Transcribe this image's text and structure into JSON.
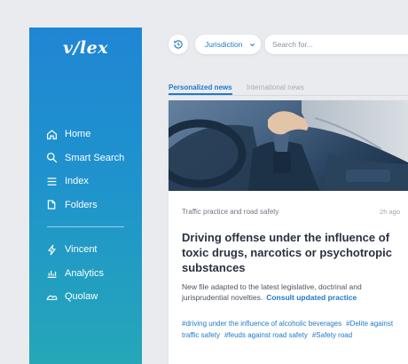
{
  "brand": {
    "logo": "v/lex"
  },
  "sidebar": {
    "items": [
      {
        "label": "Home",
        "icon": "home-icon"
      },
      {
        "label": "Smart Search",
        "icon": "search-icon"
      },
      {
        "label": "Index",
        "icon": "list-icon"
      },
      {
        "label": "Folders",
        "icon": "folder-icon"
      }
    ],
    "tools": [
      {
        "label": "Vincent",
        "icon": "lightning-icon"
      },
      {
        "label": "Analytics",
        "icon": "bar-chart-icon"
      },
      {
        "label": "Quolaw",
        "icon": "cloud-icon"
      }
    ]
  },
  "topbar": {
    "history_icon": "history-icon",
    "jurisdiction_label": "Jurisdiction",
    "search_placeholder": "Search for..."
  },
  "tabs": [
    {
      "label": "Personalized news",
      "active": true
    },
    {
      "label": "International news",
      "active": false
    }
  ],
  "article": {
    "category": "Traffic practice and road safety",
    "time": "2h ago",
    "title": "Driving offense under the influence of toxic drugs, narcotics or psychotropic substances",
    "summary": "New file adapted to the latest legislative, doctrinal and jurisprudential novelties.",
    "link_label": "Consult updated practice",
    "tags": [
      "#driving under the influence of alcoholic beverages",
      "#Delite against traffic safety",
      "#feuds against road safety",
      "#Safety road"
    ]
  },
  "colors": {
    "accent": "#1f7ac7",
    "sidebar_top": "#1f86d4",
    "sidebar_bottom": "#25a7b8"
  }
}
